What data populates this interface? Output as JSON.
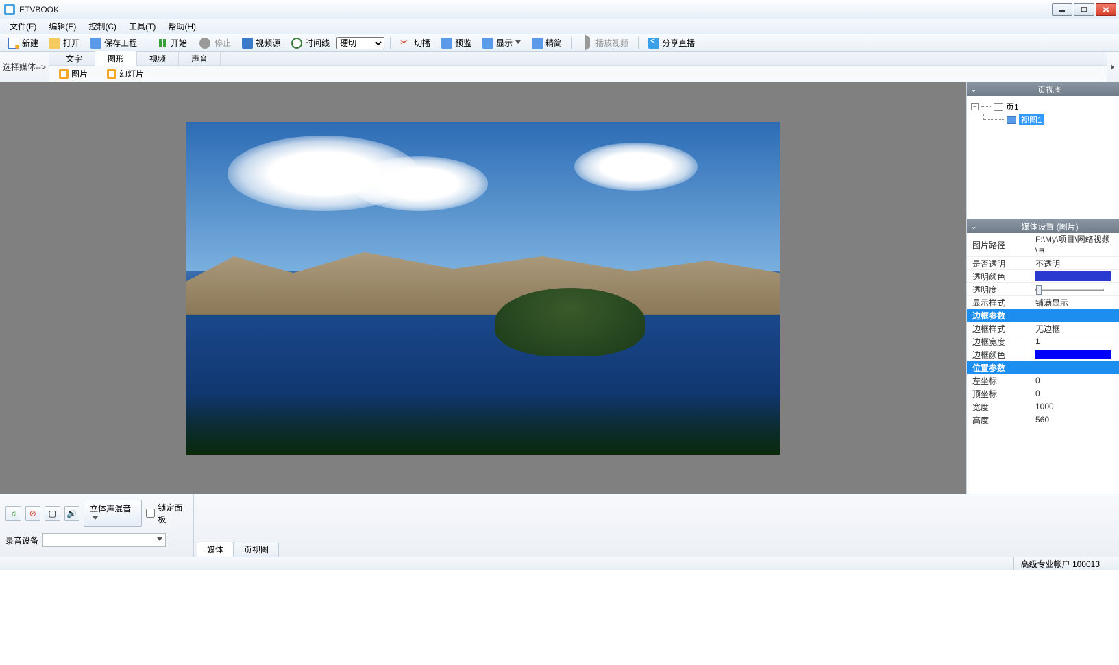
{
  "app": {
    "title": "ETVBOOK"
  },
  "menu": {
    "file": "文件(F)",
    "edit": "编辑(E)",
    "control": "控制(C)",
    "tools": "工具(T)",
    "help": "帮助(H)"
  },
  "toolbar": {
    "new": "新建",
    "open": "打开",
    "save_project": "保存工程",
    "start": "开始",
    "stop": "停止",
    "video_source": "视频源",
    "timeline": "时间线",
    "transition_options": [
      "硬切"
    ],
    "transition_selected": "硬切",
    "cut": "切播",
    "preview": "预监",
    "display": "显示",
    "compact": "精简",
    "play_video": "播放视频",
    "share_live": "分享直播"
  },
  "media_selector": {
    "label": "选择媒体-->",
    "tabs": {
      "text": "文字",
      "shape": "图形",
      "video": "视频",
      "sound": "声音"
    },
    "sub": {
      "image": "图片",
      "slide": "幻灯片"
    }
  },
  "page_tree": {
    "title": "页视图",
    "root": "页1",
    "item": "视图1"
  },
  "media_settings": {
    "title": "媒体设置  (图片)",
    "rows": {
      "image_path_label": "图片路径",
      "image_path_value": "F:\\My\\项目\\网络视频\\ㅋ",
      "is_transparent_label": "是否透明",
      "is_transparent_value": "不透明",
      "transparent_color_label": "透明颜色",
      "transparent_color_value": "#2a3ad0",
      "opacity_label": "透明度",
      "display_style_label": "显示样式",
      "display_style_value": "铺满显示",
      "border_section": "边框参数",
      "border_style_label": "边框样式",
      "border_style_value": "无边框",
      "border_width_label": "边框宽度",
      "border_width_value": "1",
      "border_color_label": "边框颜色",
      "border_color_value": "#0000ff",
      "position_section": "位置参数",
      "left_label": "左坐标",
      "left_value": "0",
      "top_label": "顶坐标",
      "top_value": "0",
      "width_label": "宽度",
      "width_value": "1000",
      "height_label": "高度",
      "height_value": "560"
    }
  },
  "bottom": {
    "stereo_mix": "立体声混音",
    "lock_panel": "锁定面板",
    "record_device": "录音设备",
    "tabs": {
      "media": "媒体",
      "page_view": "页视图"
    }
  },
  "status": {
    "account": "高级专业帐户 100013"
  }
}
